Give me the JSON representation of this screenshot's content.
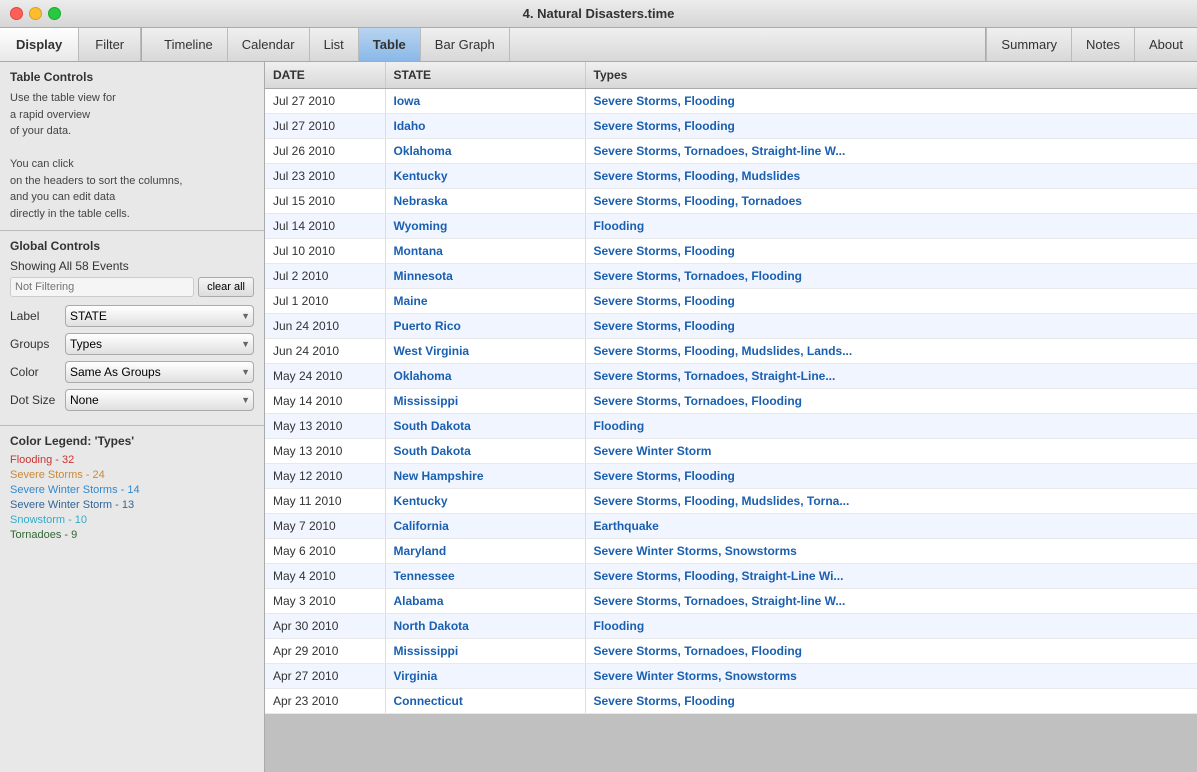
{
  "window": {
    "title": "4. Natural Disasters.time"
  },
  "toolbar": {
    "left_tabs": [
      {
        "label": "Display",
        "active": true
      },
      {
        "label": "Filter",
        "active": false
      }
    ],
    "center_tabs": [
      {
        "label": "Timeline",
        "active": false
      },
      {
        "label": "Calendar",
        "active": false
      },
      {
        "label": "List",
        "active": false
      },
      {
        "label": "Table",
        "active": true
      },
      {
        "label": "Bar Graph",
        "active": false
      }
    ],
    "right_tabs": [
      {
        "label": "Summary",
        "active": false
      },
      {
        "label": "Notes",
        "active": false
      },
      {
        "label": "About",
        "active": false
      }
    ]
  },
  "sidebar": {
    "table_controls_title": "Table Controls",
    "info_lines": [
      "Use the table view for",
      "a rapid overview",
      "of your data.",
      "",
      "You can click",
      "on the headers to sort the columns,",
      "and you can edit data",
      "directly in the table cells."
    ],
    "global_controls_title": "Global Controls",
    "showing_events": "Showing All 58 Events",
    "filter_placeholder": "Not Filtering",
    "clear_all_label": "clear all",
    "label_label": "Label",
    "label_value": "STATE",
    "groups_label": "Groups",
    "groups_value": "Types",
    "color_label": "Color",
    "color_value": "Same As Groups",
    "dot_size_label": "Dot Size",
    "dot_size_value": "None",
    "color_legend_title": "Color Legend: 'Types'",
    "legend_items": [
      {
        "label": "Flooding - 32",
        "color": "#cc3333"
      },
      {
        "label": "Severe Storms - 24",
        "color": "#cc8833"
      },
      {
        "label": "Severe Winter Storms - 14",
        "color": "#3388cc"
      },
      {
        "label": "Severe Winter Storm - 13",
        "color": "#336699"
      },
      {
        "label": "Snowstorm - 10",
        "color": "#33aacc"
      },
      {
        "label": "Tornadoes - 9",
        "color": "#336633"
      }
    ]
  },
  "table": {
    "columns": [
      "DATE",
      "STATE",
      "Types"
    ],
    "rows": [
      {
        "date": "Jul 27 2010",
        "state": "Iowa",
        "types": "Severe Storms, Flooding"
      },
      {
        "date": "Jul 27 2010",
        "state": "Idaho",
        "types": "Severe Storms, Flooding"
      },
      {
        "date": "Jul 26 2010",
        "state": "Oklahoma",
        "types": "Severe Storms, Tornadoes, Straight-line W..."
      },
      {
        "date": "Jul 23 2010",
        "state": "Kentucky",
        "types": "Severe Storms, Flooding, Mudslides"
      },
      {
        "date": "Jul 15 2010",
        "state": "Nebraska",
        "types": "Severe Storms, Flooding, Tornadoes"
      },
      {
        "date": "Jul 14 2010",
        "state": "Wyoming",
        "types": "Flooding"
      },
      {
        "date": "Jul 10 2010",
        "state": "Montana",
        "types": "Severe Storms, Flooding"
      },
      {
        "date": "Jul 2 2010",
        "state": "Minnesota",
        "types": "Severe Storms, Tornadoes, Flooding"
      },
      {
        "date": "Jul 1 2010",
        "state": "Maine",
        "types": "Severe Storms, Flooding"
      },
      {
        "date": "Jun 24 2010",
        "state": "Puerto Rico",
        "types": "Severe Storms, Flooding"
      },
      {
        "date": "Jun 24 2010",
        "state": "West Virginia",
        "types": "Severe Storms, Flooding, Mudslides, Lands..."
      },
      {
        "date": "May 24 2010",
        "state": "Oklahoma",
        "types": "Severe Storms, Tornadoes, Straight-Line..."
      },
      {
        "date": "May 14 2010",
        "state": "Mississippi",
        "types": "Severe Storms, Tornadoes, Flooding"
      },
      {
        "date": "May 13 2010",
        "state": "South Dakota",
        "types": "Flooding"
      },
      {
        "date": "May 13 2010",
        "state": "South Dakota",
        "types": "Severe Winter Storm"
      },
      {
        "date": "May 12 2010",
        "state": "New Hampshire",
        "types": "Severe Storms, Flooding"
      },
      {
        "date": "May 11 2010",
        "state": "Kentucky",
        "types": "Severe Storms, Flooding, Mudslides, Torna..."
      },
      {
        "date": "May 7 2010",
        "state": "California",
        "types": "Earthquake"
      },
      {
        "date": "May 6 2010",
        "state": "Maryland",
        "types": "Severe Winter Storms, Snowstorms"
      },
      {
        "date": "May 4 2010",
        "state": "Tennessee",
        "types": "Severe Storms, Flooding, Straight-Line Wi..."
      },
      {
        "date": "May 3 2010",
        "state": "Alabama",
        "types": "Severe Storms, Tornadoes, Straight-line W..."
      },
      {
        "date": "Apr 30 2010",
        "state": "North Dakota",
        "types": "Flooding"
      },
      {
        "date": "Apr 29 2010",
        "state": "Mississippi",
        "types": "Severe Storms, Tornadoes, Flooding"
      },
      {
        "date": "Apr 27 2010",
        "state": "Virginia",
        "types": "Severe Winter Storms, Snowstorms"
      },
      {
        "date": "Apr 23 2010",
        "state": "Connecticut",
        "types": "Severe Storms, Flooding"
      }
    ]
  }
}
